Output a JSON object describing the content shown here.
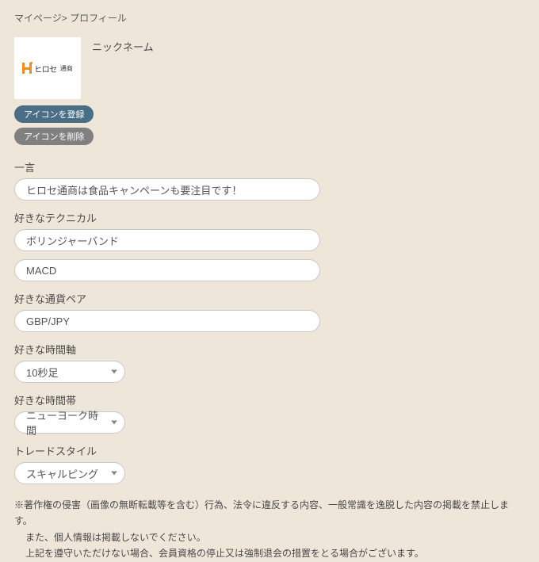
{
  "breadcrumb": {
    "part1": "マイページ",
    "separator": ">",
    "part2": "プロフィール"
  },
  "nickname_label": "ニックネーム",
  "avatar_brand_main": "ヒロセ",
  "avatar_brand_sub": "通商",
  "buttons": {
    "register_icon": "アイコンを登録",
    "delete_icon": "アイコンを削除"
  },
  "sections": {
    "hitokoto_label": "一言",
    "hitokoto_value": "ヒロセ通商は食品キャンペーンも要注目です！",
    "technical_label": "好きなテクニカル",
    "technical_value1": "ボリンジャーバンド",
    "technical_value2": "MACD",
    "pair_label": "好きな通貨ペア",
    "pair_value": "GBP/JPY",
    "timeframe_label": "好きな時間軸",
    "timeframe_value": "10秒足",
    "timezone_label": "好きな時間帯",
    "timezone_value": "ニューヨーク時間",
    "style_label": "トレードスタイル",
    "style_value": "スキャルピング"
  },
  "notes": {
    "line1": "※著作権の侵害（画像の無断転載等を含む）行為、法令に違反する内容、一般常識を逸脱した内容の掲載を禁止します。",
    "line2": "また、個人情報は掲載しないでください。",
    "line3": "上記を遵守いただけない場合、会員資格の停止又は強制退会の措置をとる場合がございます。"
  }
}
